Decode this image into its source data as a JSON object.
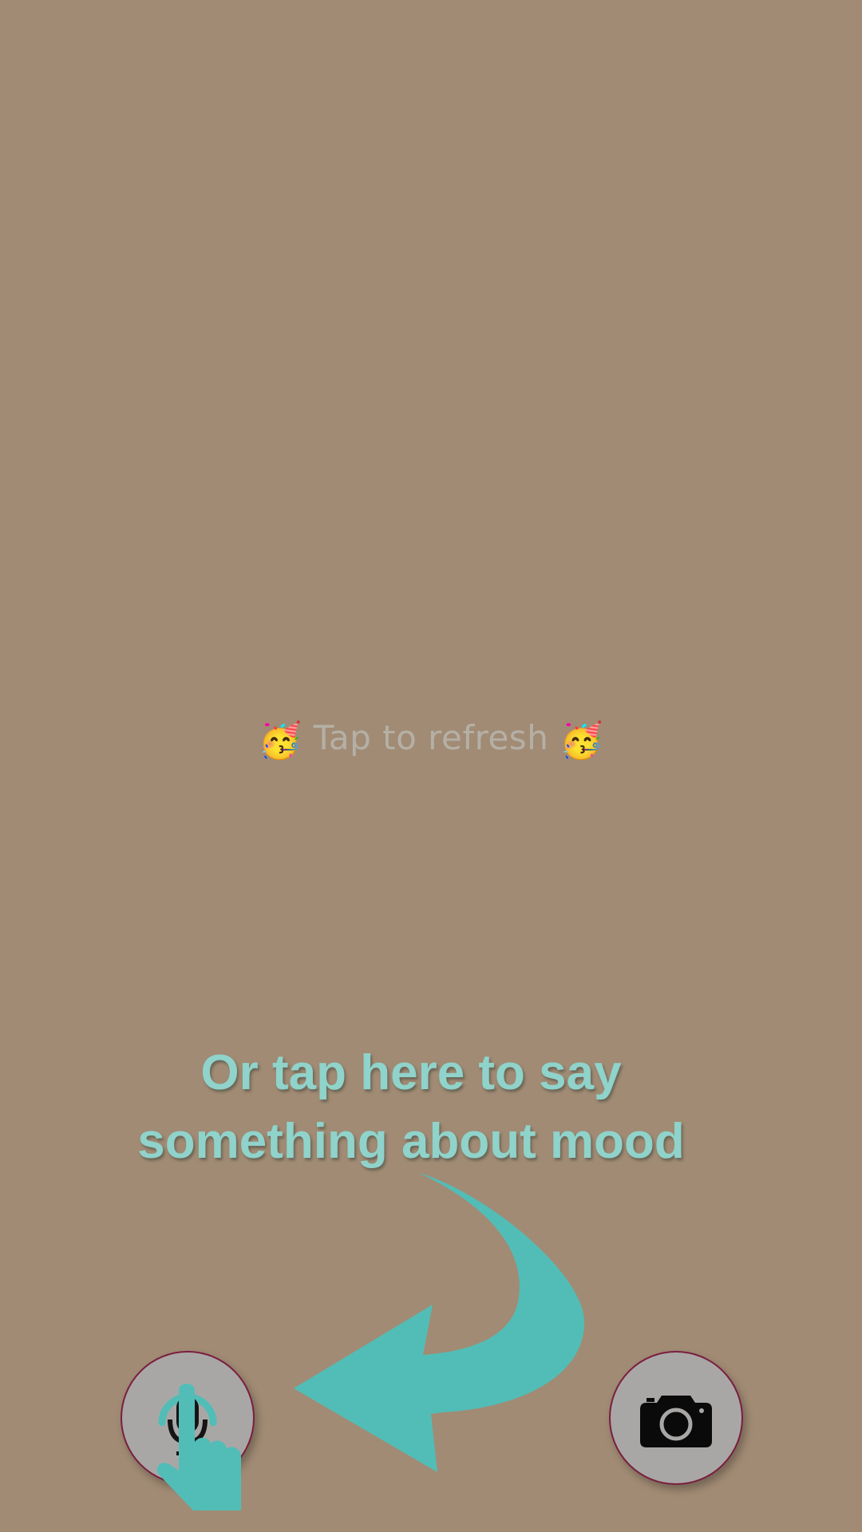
{
  "refresh": {
    "emoji_left": "🥳",
    "label": "Tap to refresh",
    "emoji_right": "🥳"
  },
  "hint": {
    "line1": "Or tap here to say",
    "line2": "something about mood"
  },
  "buttons": {
    "mic_icon": "microphone-icon",
    "camera_icon": "camera-icon"
  },
  "colors": {
    "background": "#a18b74",
    "accent": "#52bdb7",
    "hint_text": "#8fd3cb",
    "button_fill": "#a9a7a6",
    "button_border": "#7a1e3f"
  }
}
